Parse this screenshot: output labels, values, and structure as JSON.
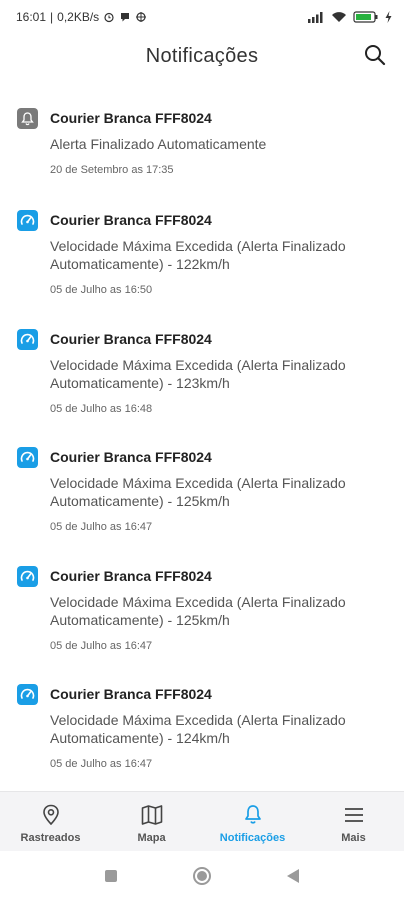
{
  "status_bar": {
    "time": "16:01",
    "network_speed": "0,2KB/s",
    "left_icons": [
      "alarm-icon",
      "chat-bubble-icon",
      "vpn-icon"
    ],
    "right_icons": [
      "signal-icon",
      "wifi-icon",
      "battery-icon",
      "charging-icon"
    ]
  },
  "header": {
    "title": "Notificações",
    "search_icon": "search-icon"
  },
  "notifications": [
    {
      "icon": "bell-icon",
      "icon_color": "#7a7a7a",
      "title": "Courier Branca FFF8024",
      "message": "Alerta Finalizado Automaticamente",
      "date": "20 de Setembro as 17:35"
    },
    {
      "icon": "speedometer-icon",
      "icon_color": "#1a9ee6",
      "title": "Courier Branca FFF8024",
      "message_line1": "Velocidade Máxima Excedida (Alerta Finalizado",
      "message_line2": "Automaticamente) - 122km/h",
      "date": "05 de Julho as 16:50"
    },
    {
      "icon": "speedometer-icon",
      "icon_color": "#1a9ee6",
      "title": "Courier Branca FFF8024",
      "message_line1": "Velocidade Máxima Excedida (Alerta Finalizado",
      "message_line2": "Automaticamente) - 123km/h",
      "date": "05 de Julho as 16:48"
    },
    {
      "icon": "speedometer-icon",
      "icon_color": "#1a9ee6",
      "title": "Courier Branca FFF8024",
      "message_line1": "Velocidade Máxima Excedida (Alerta Finalizado",
      "message_line2": "Automaticamente) - 125km/h",
      "date": "05 de Julho as 16:47"
    },
    {
      "icon": "speedometer-icon",
      "icon_color": "#1a9ee6",
      "title": "Courier Branca FFF8024",
      "message_line1": "Velocidade Máxima Excedida (Alerta Finalizado",
      "message_line2": "Automaticamente) - 125km/h",
      "date": "05 de Julho as 16:47"
    },
    {
      "icon": "speedometer-icon",
      "icon_color": "#1a9ee6",
      "title": "Courier Branca FFF8024",
      "message_line1": "Velocidade Máxima Excedida (Alerta Finalizado",
      "message_line2": "Automaticamente) - 124km/h",
      "date": "05 de Julho as 16:47"
    }
  ],
  "bottom_nav": {
    "active": "Notificações",
    "active_color": "#1a9ee6",
    "items": [
      {
        "label": "Rastreados",
        "icon": "location-pin-icon"
      },
      {
        "label": "Mapa",
        "icon": "map-icon"
      },
      {
        "label": "Notificações",
        "icon": "bell-icon"
      },
      {
        "label": "Mais",
        "icon": "menu-icon"
      }
    ]
  },
  "system_nav": {
    "icons": [
      "recents-square-icon",
      "home-circle-icon",
      "back-triangle-icon"
    ]
  }
}
